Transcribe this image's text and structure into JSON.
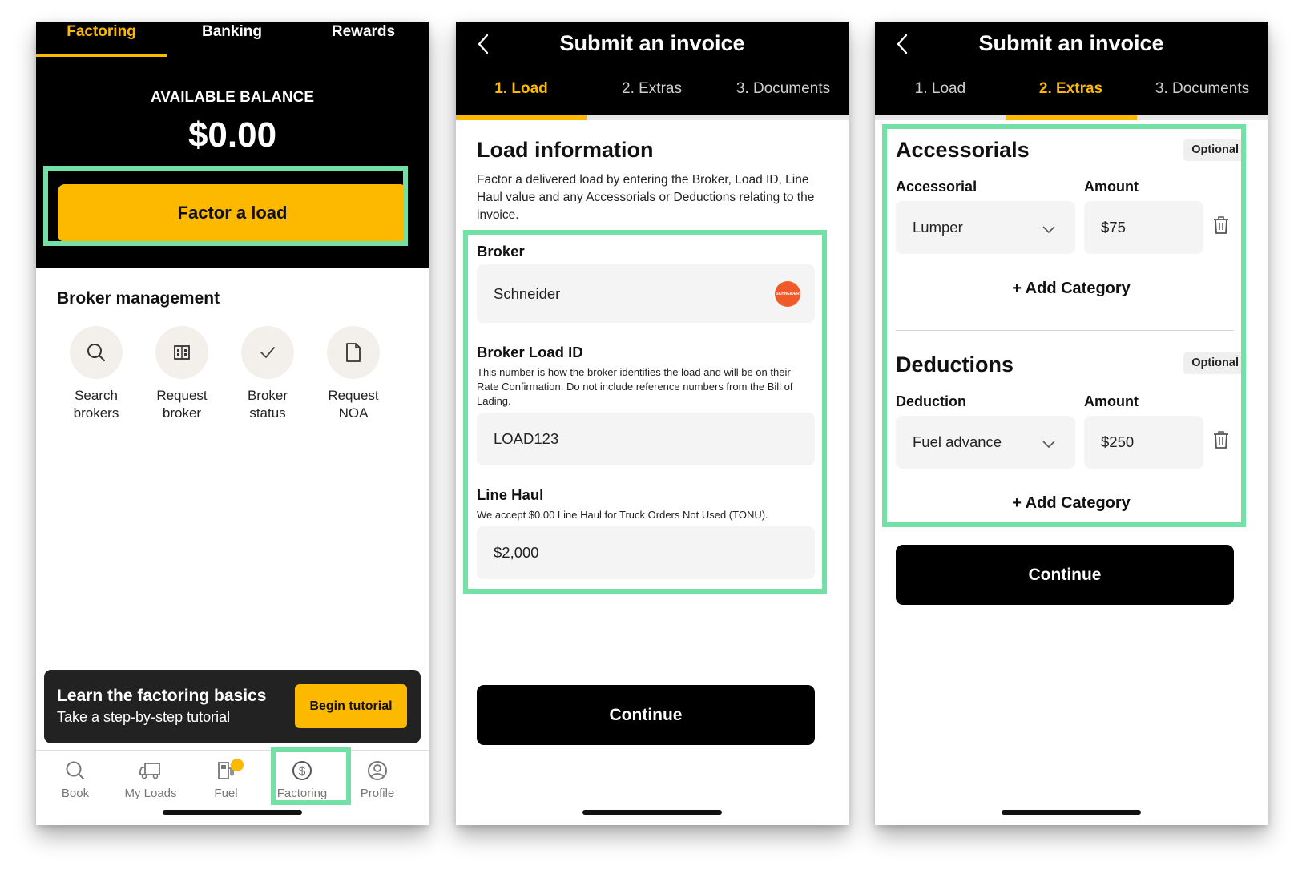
{
  "colors": {
    "accent": "#fcb900",
    "highlight": "#73e0a6",
    "dark": "#000000",
    "input_bg": "#f4f4f4"
  },
  "screen1": {
    "tabs": [
      {
        "label": "Factoring",
        "active": true
      },
      {
        "label": "Banking",
        "active": false
      },
      {
        "label": "Rewards",
        "active": false
      }
    ],
    "balance_label": "AVAILABLE BALANCE",
    "balance_value": "$0.00",
    "factor_button": "Factor a load",
    "broker_management": {
      "title": "Broker management",
      "items": [
        {
          "label": "Search\nbrokers",
          "icon": "search-icon"
        },
        {
          "label": "Request\nbroker",
          "icon": "building-icon"
        },
        {
          "label": "Broker\nstatus",
          "icon": "check-icon"
        },
        {
          "label": "Request\nNOA",
          "icon": "document-icon"
        }
      ]
    },
    "tutorial": {
      "title": "Learn the factoring basics",
      "subtitle": "Take a step-by-step tutorial",
      "button": "Begin tutorial"
    },
    "nav": [
      {
        "label": "Book",
        "icon": "search-icon"
      },
      {
        "label": "My Loads",
        "icon": "truck-icon"
      },
      {
        "label": "Fuel",
        "icon": "fuel-pump-icon"
      },
      {
        "label": "Factoring",
        "icon": "dollar-circle-icon",
        "active": true
      },
      {
        "label": "Profile",
        "icon": "user-circle-icon"
      }
    ]
  },
  "screen2": {
    "title": "Submit an invoice",
    "steps": [
      {
        "label": "1.  Load",
        "active": true
      },
      {
        "label": "2.  Extras",
        "active": false
      },
      {
        "label": "3.  Documents",
        "active": false
      }
    ],
    "section_title": "Load information",
    "description": "Factor a delivered load by entering the Broker, Load ID, Line Haul value and any Accessorials or Deductions relating to the invoice.",
    "broker_label": "Broker",
    "broker_value": "Schneider",
    "broker_logo_text": "SCHNEIDER",
    "load_id_label": "Broker Load ID",
    "load_id_helper": "This number is how the broker identifies the load and will be on their Rate Confirmation. Do not include reference numbers from the Bill of Lading.",
    "load_id_value": "LOAD123",
    "line_haul_label": "Line Haul",
    "line_haul_helper": "We accept $0.00 Line Haul for Truck Orders Not Used (TONU).",
    "line_haul_value": "$2,000",
    "continue": "Continue"
  },
  "screen3": {
    "title": "Submit an invoice",
    "steps": [
      {
        "label": "1.  Load",
        "active": false
      },
      {
        "label": "2.  Extras",
        "active": true
      },
      {
        "label": "3.  Documents",
        "active": false
      }
    ],
    "accessorials": {
      "title": "Accessorials",
      "badge": "Optional",
      "type_label": "Accessorial",
      "amount_label": "Amount",
      "type_value": "Lumper",
      "amount_value": "$75",
      "add": "+ Add Category"
    },
    "deductions": {
      "title": "Deductions",
      "badge": "Optional",
      "type_label": "Deduction",
      "amount_label": "Amount",
      "type_value": "Fuel advance",
      "amount_value": "$250",
      "add": "+ Add Category"
    },
    "continue": "Continue"
  }
}
